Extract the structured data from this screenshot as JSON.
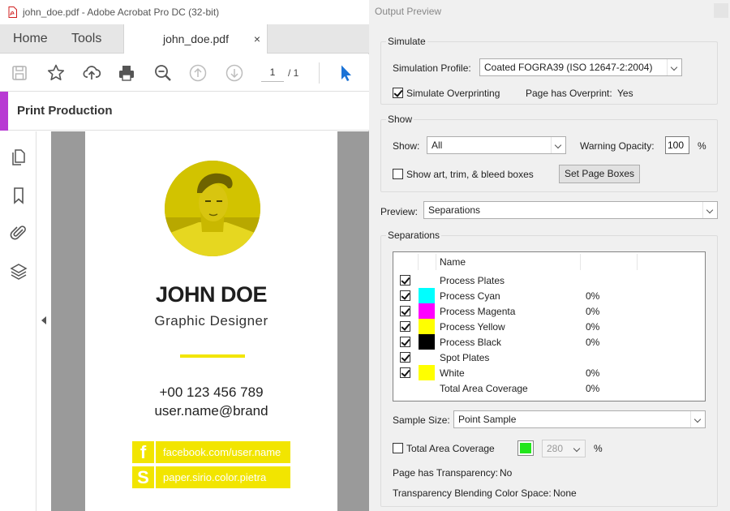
{
  "window": {
    "title": "john_doe.pdf - Adobe Acrobat Pro DC (32-bit)"
  },
  "nav": {
    "home": "Home",
    "tools": "Tools",
    "tab_label": "john_doe.pdf",
    "tab_close": "×"
  },
  "toolbar": {
    "page_current": "1",
    "page_total": "/ 1"
  },
  "panel": {
    "title": "Print Production",
    "accent_color": "#b83ad3"
  },
  "card": {
    "name": "JOHN DOE",
    "role": "Graphic Designer",
    "phone": "+00 123 456 789",
    "email": "user.name@brand",
    "socials": [
      {
        "letter": "f",
        "text": "facebook.com/user.name"
      },
      {
        "letter": "S",
        "text": "paper.sirio.color.pietra"
      }
    ],
    "accent_color": "#f2e500"
  },
  "output_preview": {
    "title": "Output Preview",
    "simulate": {
      "legend": "Simulate",
      "profile_label": "Simulation Profile:",
      "profile_value": "Coated FOGRA39 (ISO 12647-2:2004)",
      "overprint_label": "Simulate Overprinting",
      "overprint_checked": true,
      "has_overprint_label": "Page has Overprint:",
      "has_overprint_value": "Yes"
    },
    "show": {
      "legend": "Show",
      "show_label": "Show:",
      "show_value": "All",
      "warning_label": "Warning Opacity:",
      "warning_value": "100",
      "percent": "%",
      "boxes_label": "Show art, trim, & bleed boxes",
      "boxes_checked": false,
      "set_boxes_button": "Set Page Boxes"
    },
    "preview": {
      "label": "Preview:",
      "value": "Separations"
    },
    "separations": {
      "legend": "Separations",
      "column_name": "Name",
      "rows": [
        {
          "name": "Process Plates",
          "checked": true,
          "swatch": "",
          "value": ""
        },
        {
          "name": "Process Cyan",
          "checked": true,
          "swatch": "#00ffff",
          "value": "0%"
        },
        {
          "name": "Process Magenta",
          "checked": true,
          "swatch": "#ff00ff",
          "value": "0%"
        },
        {
          "name": "Process Yellow",
          "checked": true,
          "swatch": "#ffff00",
          "value": "0%"
        },
        {
          "name": "Process Black",
          "checked": true,
          "swatch": "#000000",
          "value": "0%"
        },
        {
          "name": "Spot Plates",
          "checked": true,
          "swatch": "",
          "value": ""
        },
        {
          "name": "White",
          "checked": true,
          "swatch": "#ffff00",
          "value": "0%"
        },
        {
          "name": "Total Area Coverage",
          "checked": null,
          "swatch": "",
          "value": "0%"
        }
      ],
      "sample_label": "Sample Size:",
      "sample_value": "Point Sample",
      "tac_label": "Total Area Coverage",
      "tac_checked": false,
      "tac_color": "#22e61c",
      "tac_value": "280",
      "tac_percent": "%",
      "transparency_label": "Page has Transparency:",
      "transparency_value": "No",
      "blend_label": "Transparency Blending Color Space:",
      "blend_value": "None"
    }
  }
}
